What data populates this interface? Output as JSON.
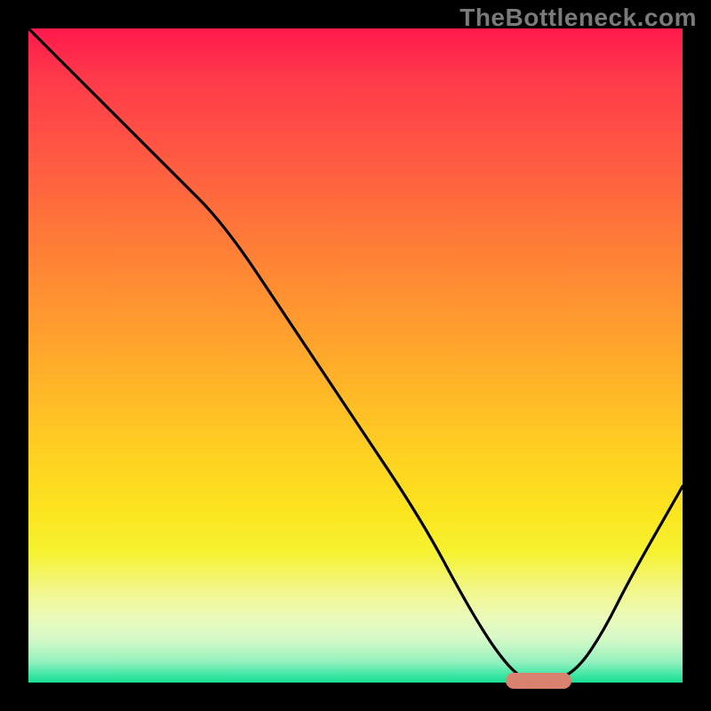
{
  "watermark": "TheBottleneck.com",
  "colors": {
    "frame_bg": "#000000",
    "watermark_text": "#7a7a7a",
    "curve_stroke": "#000000",
    "marker_fill": "#d9826f"
  },
  "chart_data": {
    "type": "line",
    "title": "",
    "xlabel": "",
    "ylabel": "",
    "xlim": [
      0,
      100
    ],
    "ylim": [
      0,
      100
    ],
    "series": [
      {
        "name": "bottleneck-curve",
        "x": [
          0,
          12,
          22,
          30,
          40,
          50,
          60,
          67,
          72,
          76,
          80,
          84,
          88,
          92,
          100
        ],
        "y": [
          100,
          88,
          78,
          70,
          55,
          40,
          25,
          12,
          4,
          0,
          0,
          2,
          8,
          16,
          30
        ]
      }
    ],
    "marker": {
      "x_start": 73,
      "x_end": 83,
      "y": 0
    },
    "background_gradient": {
      "top": "#ff1a4d",
      "mid_upper": "#ff9930",
      "mid": "#ffd321",
      "mid_lower": "#f2f78c",
      "bottom": "#18df93"
    }
  }
}
